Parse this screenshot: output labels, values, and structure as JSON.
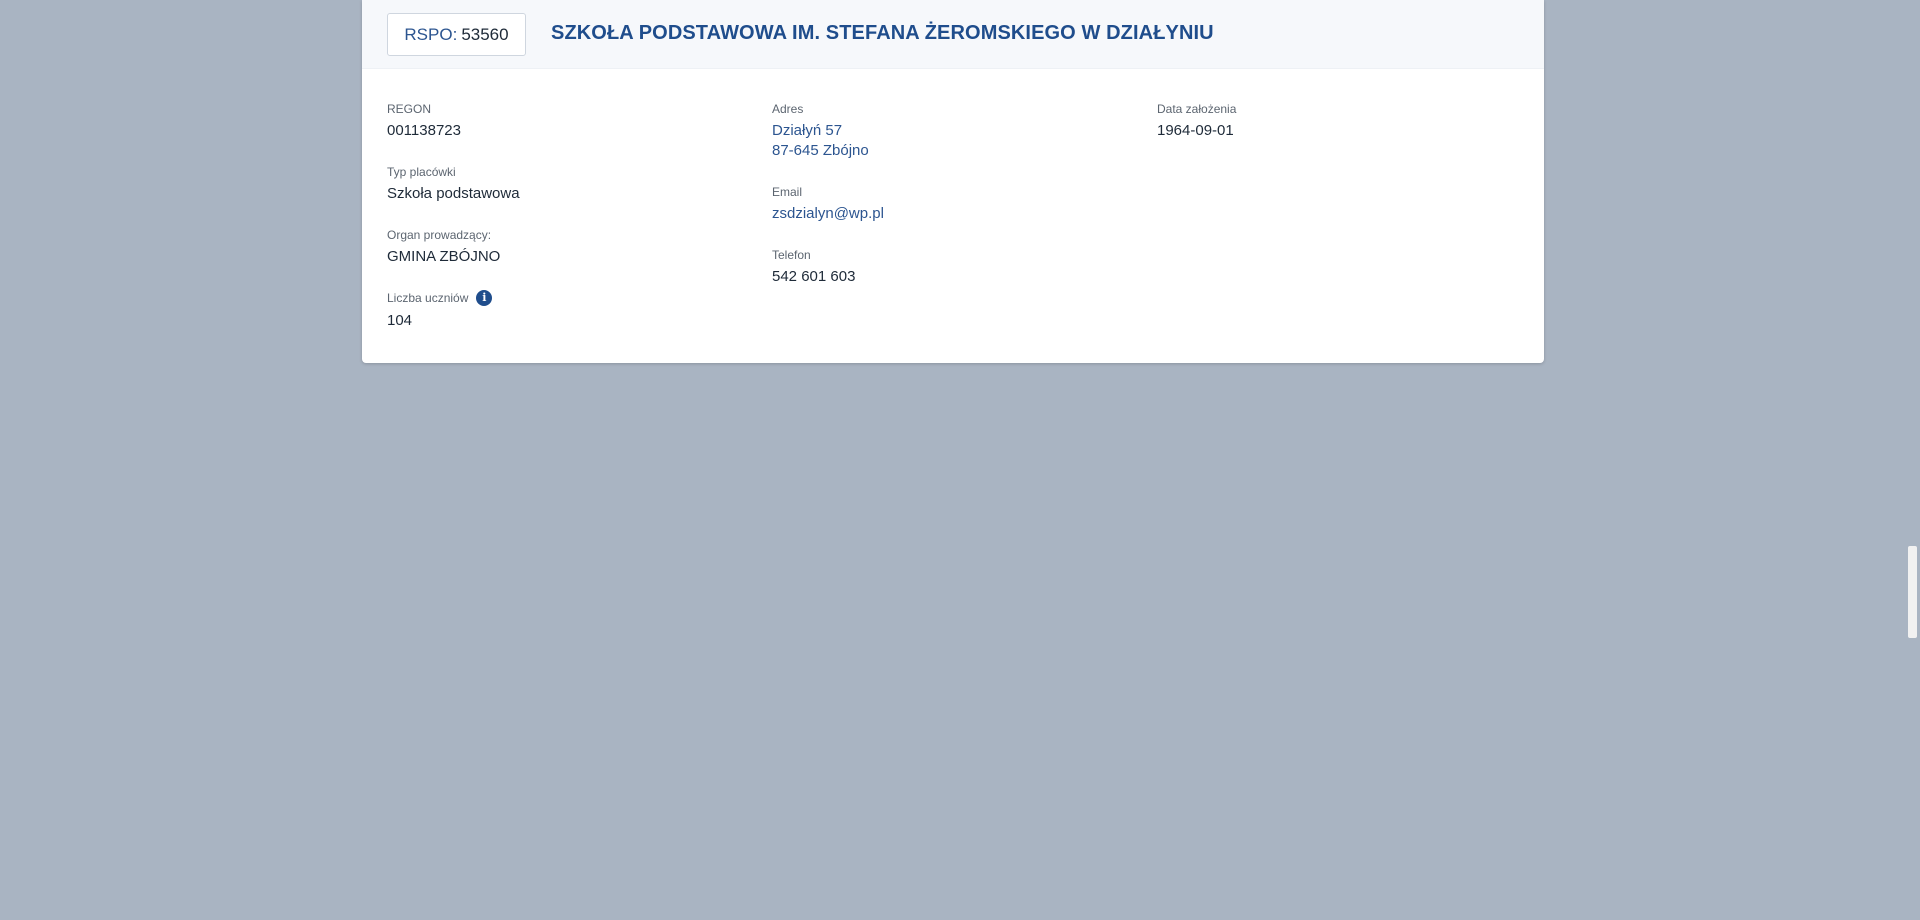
{
  "header": {
    "rspo_label": "RSPO:",
    "rspo_value": "53560",
    "school_name": "SZKOŁA PODSTAWOWA IM. STEFANA ŻEROMSKIEGO W DZIAŁYNIU"
  },
  "fields": {
    "regon": {
      "label": "REGON",
      "value": "001138723"
    },
    "typ": {
      "label": "Typ placówki",
      "value": "Szkoła podstawowa"
    },
    "organ": {
      "label": "Organ prowadzący:",
      "value": "GMINA ZBÓJNO"
    },
    "uczniowie": {
      "label": "Liczba uczniów",
      "value": "104",
      "icon": "info-icon"
    },
    "adres": {
      "label": "Adres",
      "line1": "Działyń 57",
      "line2": "87-645 Zbójno"
    },
    "email": {
      "label": "Email",
      "value": "zsdzialyn@wp.pl"
    },
    "telefon": {
      "label": "Telefon",
      "value": "542 601 603"
    },
    "data_zalozenia": {
      "label": "Data założenia",
      "value": "1964-09-01"
    }
  },
  "colors": {
    "background": "#a9b4c2",
    "accent": "#1f4d8c",
    "link": "#2c5590",
    "text": "#1e2a38"
  }
}
